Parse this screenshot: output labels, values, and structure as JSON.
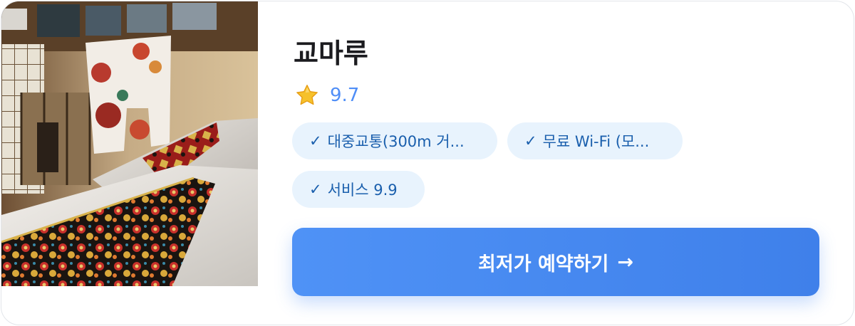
{
  "hotel": {
    "name": "교마루",
    "rating": "9.7",
    "rating_icon": "star-icon",
    "image_alt": "Japanese-style room with kimono and futon beds"
  },
  "tags": [
    {
      "check": "✓",
      "label": "대중교통(300m 거..."
    },
    {
      "check": "✓",
      "label": "무료 Wi-Fi (모..."
    },
    {
      "check": "✓",
      "label": "서비스 9.9"
    }
  ],
  "cta": {
    "label": "최저가 예약하기",
    "arrow": "→"
  },
  "colors": {
    "accent": "#4f8ef7",
    "tag_bg": "#e8f3fd",
    "tag_text": "#1a5fad",
    "button": "#4a8cf3"
  }
}
